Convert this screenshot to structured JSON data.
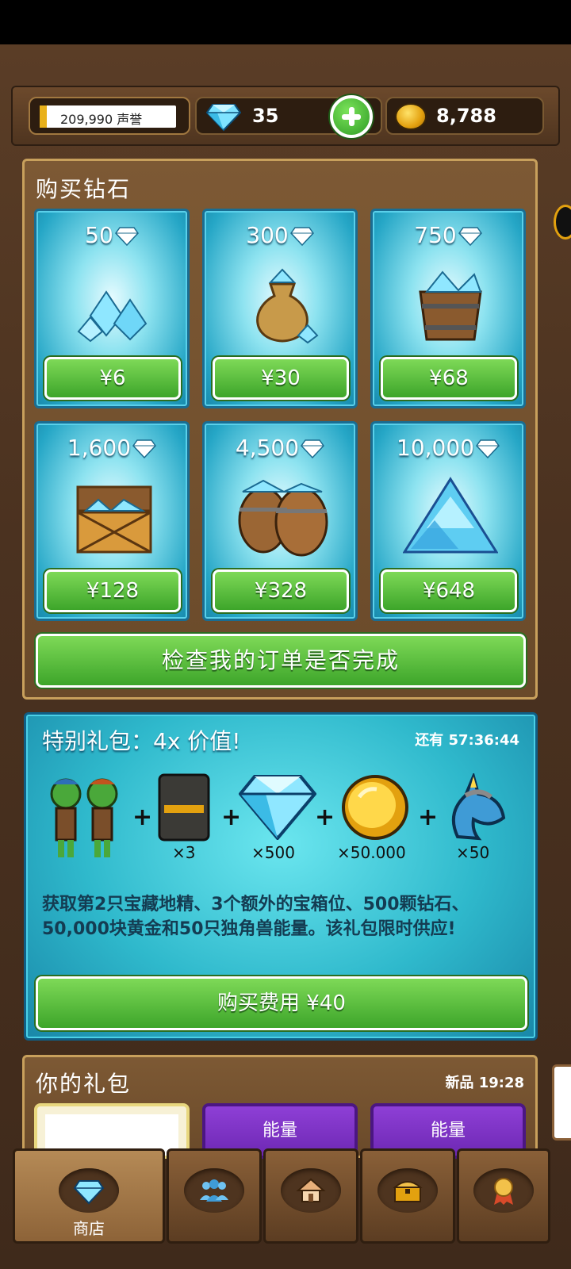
{
  "resources": {
    "reputation": "209,990 声誉",
    "reputation_progress": 0.05,
    "gems": "35",
    "gold": "8,788"
  },
  "buy_diamonds": {
    "title": "购买钻石",
    "packs": [
      {
        "amount": "50",
        "price": "¥6",
        "art": "gem-pile-icon"
      },
      {
        "amount": "300",
        "price": "¥30",
        "art": "gem-sack-icon"
      },
      {
        "amount": "750",
        "price": "¥68",
        "art": "gem-bucket-icon"
      },
      {
        "amount": "1,600",
        "price": "¥128",
        "art": "gem-chest-icon"
      },
      {
        "amount": "4,500",
        "price": "¥328",
        "art": "gem-barrels-icon"
      },
      {
        "amount": "10,000",
        "price": "¥648",
        "art": "gem-mountain-icon"
      }
    ],
    "check_orders": "检查我的订单是否完成"
  },
  "special_offer": {
    "title": "特别礼包：4x 价值!",
    "timer": "还有 57:36:44",
    "items": [
      {
        "icon": "goblins-icon",
        "label": ""
      },
      {
        "icon": "card-slot-icon",
        "label": "×3"
      },
      {
        "icon": "diamond-icon",
        "label": "×500"
      },
      {
        "icon": "gold-coin-icon",
        "label": "×50.000"
      },
      {
        "icon": "unicorn-icon",
        "label": "×50"
      }
    ],
    "plus": "+",
    "description": "获取第2只宝藏地精、3个额外的宝箱位、500颗钻石、50,000块黄金和50只独角兽能量。该礼包限时供应!",
    "buy_label": "购买费用 ¥40"
  },
  "your_bundles": {
    "title": "你的礼包",
    "new_timer": "新品 19:28",
    "cards": [
      {
        "label": ""
      },
      {
        "label": "能量"
      },
      {
        "label": "能量"
      }
    ]
  },
  "nav": {
    "tabs": [
      {
        "label": "商店",
        "icon": "diamond-icon"
      },
      {
        "label": "",
        "icon": "people-icon"
      },
      {
        "label": "",
        "icon": "house-icon"
      },
      {
        "label": "",
        "icon": "chest-icon"
      },
      {
        "label": "",
        "icon": "medal-icon"
      }
    ]
  },
  "colors": {
    "accent_green": "#4fb833",
    "panel_wood": "#7d5934",
    "card_cyan": "#25a6c6",
    "bundle_purple": "#7e34c4"
  }
}
